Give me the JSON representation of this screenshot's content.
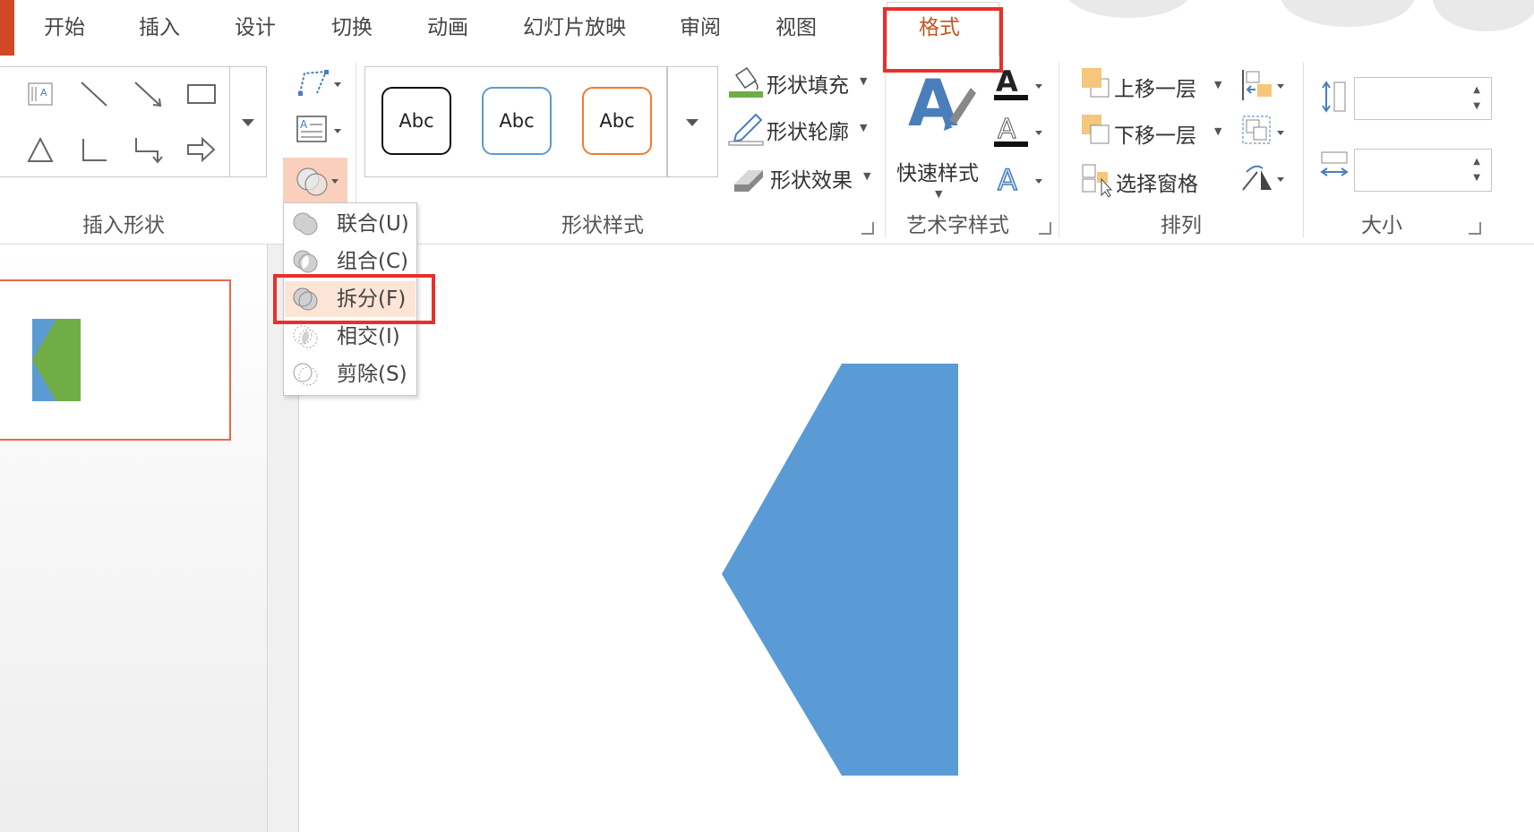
{
  "tabs": [
    {
      "label": "开始"
    },
    {
      "label": "插入"
    },
    {
      "label": "设计"
    },
    {
      "label": "切换"
    },
    {
      "label": "动画"
    },
    {
      "label": "幻灯片放映"
    },
    {
      "label": "审阅"
    },
    {
      "label": "视图"
    },
    {
      "label": "格式"
    }
  ],
  "active_tab": "格式",
  "ribbon": {
    "insert_shapes": {
      "label": "插入形状"
    },
    "shape_styles": {
      "label": "形状样式",
      "gallery": [
        "Abc",
        "Abc",
        "Abc"
      ],
      "fill": "形状填充",
      "outline": "形状轮廓",
      "effects": "形状效果"
    },
    "wordart": {
      "label": "艺术字样式",
      "quick_styles": "快速样式"
    },
    "arrange": {
      "label": "排列",
      "bring_forward": "上移一层",
      "send_backward": "下移一层",
      "selection_pane": "选择窗格"
    },
    "size": {
      "label": "大小",
      "height": "",
      "width": ""
    }
  },
  "merge_menu": {
    "items": [
      {
        "label": "联合(U)",
        "icon": "union-icon"
      },
      {
        "label": "组合(C)",
        "icon": "combine-icon"
      },
      {
        "label": "拆分(F)",
        "icon": "fragment-icon",
        "highlighted": true
      },
      {
        "label": "相交(I)",
        "icon": "intersect-icon"
      },
      {
        "label": "剪除(S)",
        "icon": "subtract-icon"
      }
    ]
  },
  "colors": {
    "accent": "#c0561e",
    "file_tab": "#d24726",
    "highlight_box": "#e8302a",
    "shape_blue": "#5b9bd5",
    "shape_green": "#70ad47",
    "fill_bar": "#70ad47",
    "menu_hover": "#fce4d6"
  }
}
